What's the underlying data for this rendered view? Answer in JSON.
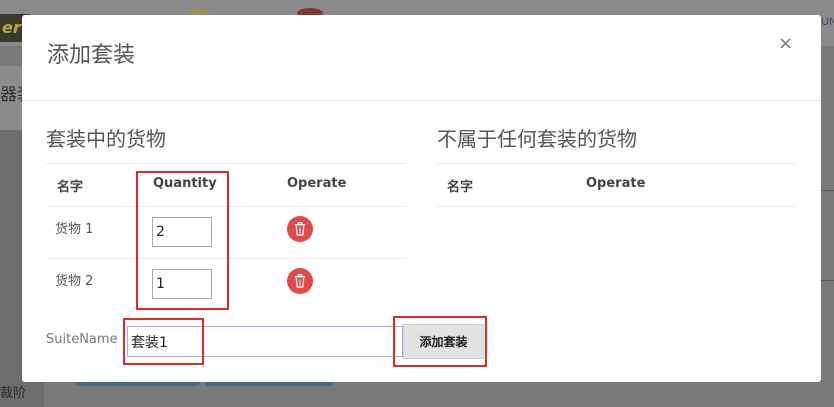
{
  "background": {
    "logo_text": "er",
    "top_right_text": "UN",
    "side_text": "器装",
    "bottom_text": "裁阶"
  },
  "modal": {
    "title": "添加套装",
    "close_glyph": "×"
  },
  "in_suite": {
    "title": "套装中的货物",
    "headers": [
      "名字",
      "Quantity",
      "Operate"
    ],
    "rows": [
      {
        "name": "货物 1",
        "quantity": "2"
      },
      {
        "name": "货物 2",
        "quantity": "1"
      }
    ]
  },
  "not_in_suite": {
    "title": "不属于任何套装的货物",
    "headers": [
      "名字",
      "Operate"
    ]
  },
  "form": {
    "suite_name_label": "SuiteName",
    "suite_name_value": "套装1",
    "add_button_label": "添加套装"
  },
  "colors": {
    "delete_button": "#e04a4a",
    "highlight_border": "#e02a2a",
    "input_focus_border": "#9bb6e0"
  },
  "icons": {
    "delete": "trash-icon",
    "close": "close-icon"
  }
}
